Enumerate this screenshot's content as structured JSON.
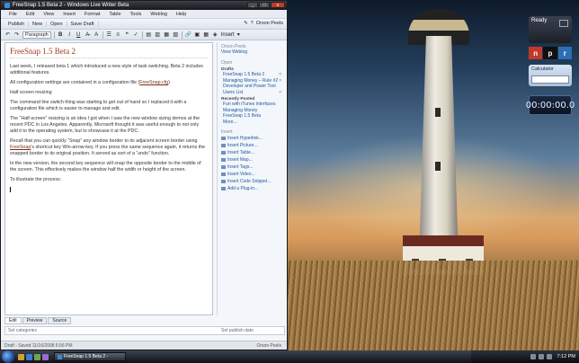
{
  "window": {
    "title": "FreeSnap 1.5 Beta 2 - Windows Live Writer Beta",
    "controls": [
      "_",
      "□",
      "x"
    ]
  },
  "menu": [
    "File",
    "Edit",
    "View",
    "Insert",
    "Format",
    "Table",
    "Tools",
    "Weblog",
    "Help"
  ],
  "toolbar1": {
    "buttons": [
      "Publish",
      "New",
      "Open",
      "Save Draft"
    ],
    "account": "Orson Peels"
  },
  "toolbar2": {
    "style_select": "Paragraph",
    "bold": "B",
    "italic": "I",
    "underline": "U",
    "insert_label": "Insert"
  },
  "post": {
    "title": "FreeSnap 1.5 Beta 2",
    "p1": "Last week, I released beta 1 which introduced a new style of task switching. Beta 2 includes additional features.",
    "p2_prefix": "All configuration settings are contained in a configuration file (",
    "p2_link": "FreeSnap.cfg",
    "p2_suffix": ")",
    "p3": "Half screen resizing",
    "p4": "The command line switch thing was starting to get out of hand so I replaced it with a configuration file which is easier to manage and edit.",
    "p5": "The “Half-screen” resizing is an idea I got when I saw the new window sizing demos at the recent PDC in Los Angeles. Apparently, Microsoft thought it was useful enough to not only add it to the operating system, but to showcase it at the PDC.",
    "p6_prefix": "Recall that you can quickly “Snap” any window border to its adjacent screen border using ",
    "p6_link": "FreeSnap",
    "p6_suffix": "’s shortcut key Win-arrow-key. If you press the same sequence again, it returns the snapped border to its original position. It served as sort of a “undo” function.",
    "p7": "In the new version, the second key sequence will snap the opposite border to the middle of the screen. This effectively makes the window half the width or height of the screen.",
    "p8": "To illustrate the process:"
  },
  "sidebar": {
    "account_header": "Orson Peels",
    "view_weblog": "View Weblog",
    "open_header": "Open",
    "drafts_header": "Drafts",
    "drafts": [
      "FreeSnap 1.5 Beta 2",
      "Managing Money – Rule #2",
      "Developer and Power Tool Users List"
    ],
    "recent_header": "Recently Posted",
    "recent": [
      "Fun with iTunes Interfaces",
      "Managing Money",
      "FreeSnap 1.5 Beta",
      "More..."
    ],
    "insert_header": "Insert",
    "insert_items": [
      "Insert Hyperlink...",
      "Insert Picture...",
      "Insert Table...",
      "Insert Map...",
      "Insert Tags...",
      "Insert Video...",
      "Insert Code Snippet...",
      "Add a Plug-in..."
    ]
  },
  "tabs": [
    "Edit",
    "Preview",
    "Source"
  ],
  "categories_placeholder": "Set categories",
  "publish_date_placeholder": "Set publish date",
  "status": {
    "text": "Draft - Saved 11/16/2008 6:56 PM",
    "account": "Orson Peels"
  },
  "gadgets": {
    "clock_label": "Ready",
    "npr": [
      "n",
      "p",
      "r"
    ],
    "calculator_label": "Calculator",
    "timer": "00:00:00.0"
  },
  "taskbar": {
    "task_label": "FreeSnap 1.5 Beta 2 -",
    "time": "7:12 PM"
  },
  "colors": {
    "title_accent": "#a43a1c",
    "link": "#1e5aa0",
    "npr_n": "#c0392b",
    "npr_p": "#111111",
    "npr_r": "#2d6fb5"
  }
}
